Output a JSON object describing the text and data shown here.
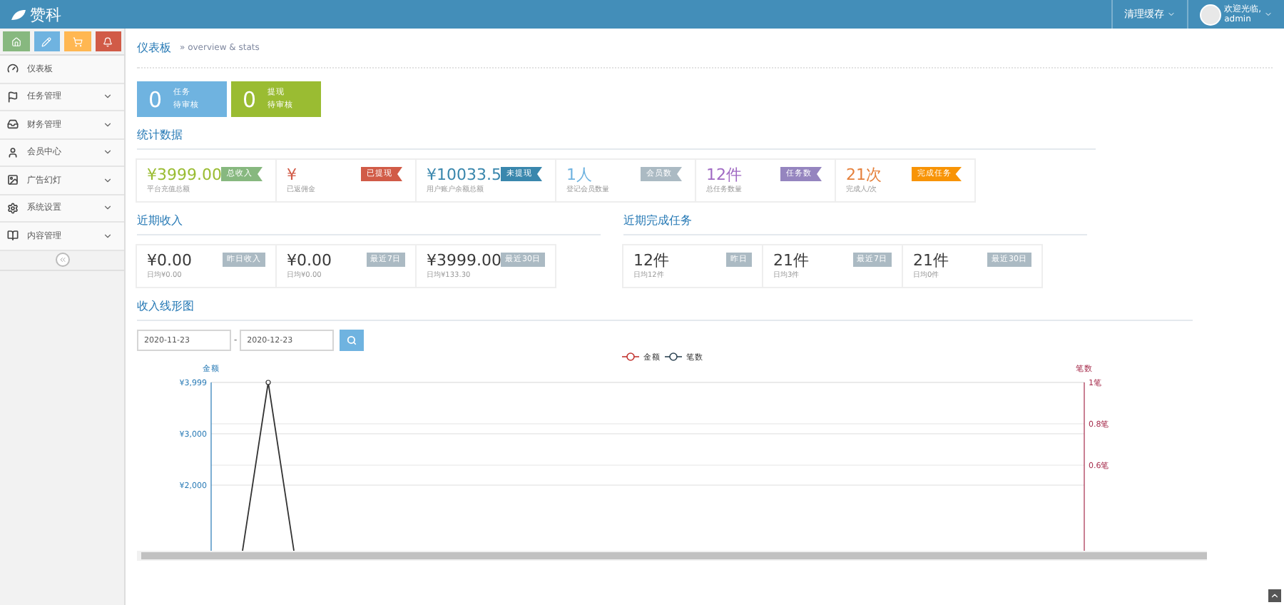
{
  "header": {
    "brand": "赞科",
    "cache_menu": "清理缓存",
    "welcome": "欢迎光临,",
    "user": "admin"
  },
  "sidebar": {
    "shortcuts": [
      {
        "kind": "home",
        "color": "#87b87f"
      },
      {
        "kind": "pencil",
        "color": "#6fb3e0"
      },
      {
        "kind": "cart",
        "color": "#ffb752"
      },
      {
        "kind": "bell",
        "color": "#d15b47"
      }
    ],
    "items": [
      {
        "kind": "dashboard",
        "label": "仪表板",
        "expandable": false
      },
      {
        "kind": "flag",
        "label": "任务管理",
        "expandable": true
      },
      {
        "kind": "inbox",
        "label": "财务管理",
        "expandable": true
      },
      {
        "kind": "user",
        "label": "会员中心",
        "expandable": true
      },
      {
        "kind": "picture",
        "label": "广告幻灯",
        "expandable": true
      },
      {
        "kind": "gear",
        "label": "系统设置",
        "expandable": true
      },
      {
        "kind": "book",
        "label": "内容管理",
        "expandable": true
      }
    ]
  },
  "breadcrumb": {
    "title": "仪表板",
    "subtitle": "» overview & stats"
  },
  "pending_tiles": [
    {
      "count": "0",
      "title": "任务",
      "subtitle": "待审核",
      "color": "#6fb3e0"
    },
    {
      "count": "0",
      "title": "提现",
      "subtitle": "待审核",
      "color": "#9abc32"
    }
  ],
  "stats": {
    "title": "统计数据",
    "cards": [
      {
        "value": "¥3999.00",
        "label": "平台充值总额",
        "color": "#9abc32",
        "tag": {
          "label": "总收入",
          "color": "#87b87f"
        }
      },
      {
        "value": "¥",
        "label": "已返佣金",
        "color": "#d15b47",
        "tag": {
          "label": "已提现",
          "color": "#d15b47"
        }
      },
      {
        "value": "¥10033.5",
        "label": "用户账户余额总额",
        "color": "#3a87ad",
        "tag": {
          "label": "未提现",
          "color": "#3a87ad"
        }
      },
      {
        "value": "1人",
        "label": "登记会员数量",
        "color": "#6fb3e0",
        "tag": {
          "label": "会员数",
          "color": "#abbac3"
        }
      },
      {
        "value": "12件",
        "label": "总任务数量",
        "color": "#a069c3",
        "tag": {
          "label": "任务数",
          "color": "#9585bf"
        }
      },
      {
        "value": "21次",
        "label": "完成人/次",
        "color": "#e5803b",
        "tag": {
          "label": "完成任务",
          "color": "#f89406"
        }
      }
    ]
  },
  "recent_income": {
    "title": "近期收入",
    "cards": [
      {
        "value": "¥0.00",
        "tag": "昨日收入",
        "note": "日均¥0.00"
      },
      {
        "value": "¥0.00",
        "tag": "最近7日",
        "note": "日均¥0.00"
      },
      {
        "value": "¥3999.00",
        "tag": "最近30日",
        "note": "日均¥133.30"
      }
    ]
  },
  "recent_tasks": {
    "title": "近期完成任务",
    "cards": [
      {
        "value": "12件",
        "tag": "昨日",
        "note": "日均12件"
      },
      {
        "value": "21件",
        "tag": "最近7日",
        "note": "日均3件"
      },
      {
        "value": "21件",
        "tag": "最近30日",
        "note": "日均0件"
      }
    ]
  },
  "income_chart": {
    "title": "收入线形图",
    "start_date": "2020-11-23",
    "separator": "-",
    "end_date": "2020-12-23",
    "left_axis_name": "金额",
    "right_axis_name": "笔数",
    "legend": [
      {
        "label": "金额",
        "color": "#c23531"
      },
      {
        "label": "笔数",
        "color": "#2f4554"
      }
    ],
    "left_ticks": [
      "¥3,999",
      "¥3,000",
      "¥2,000"
    ],
    "right_ticks": [
      "1笔",
      "0.8笔",
      "0.6笔"
    ]
  }
}
